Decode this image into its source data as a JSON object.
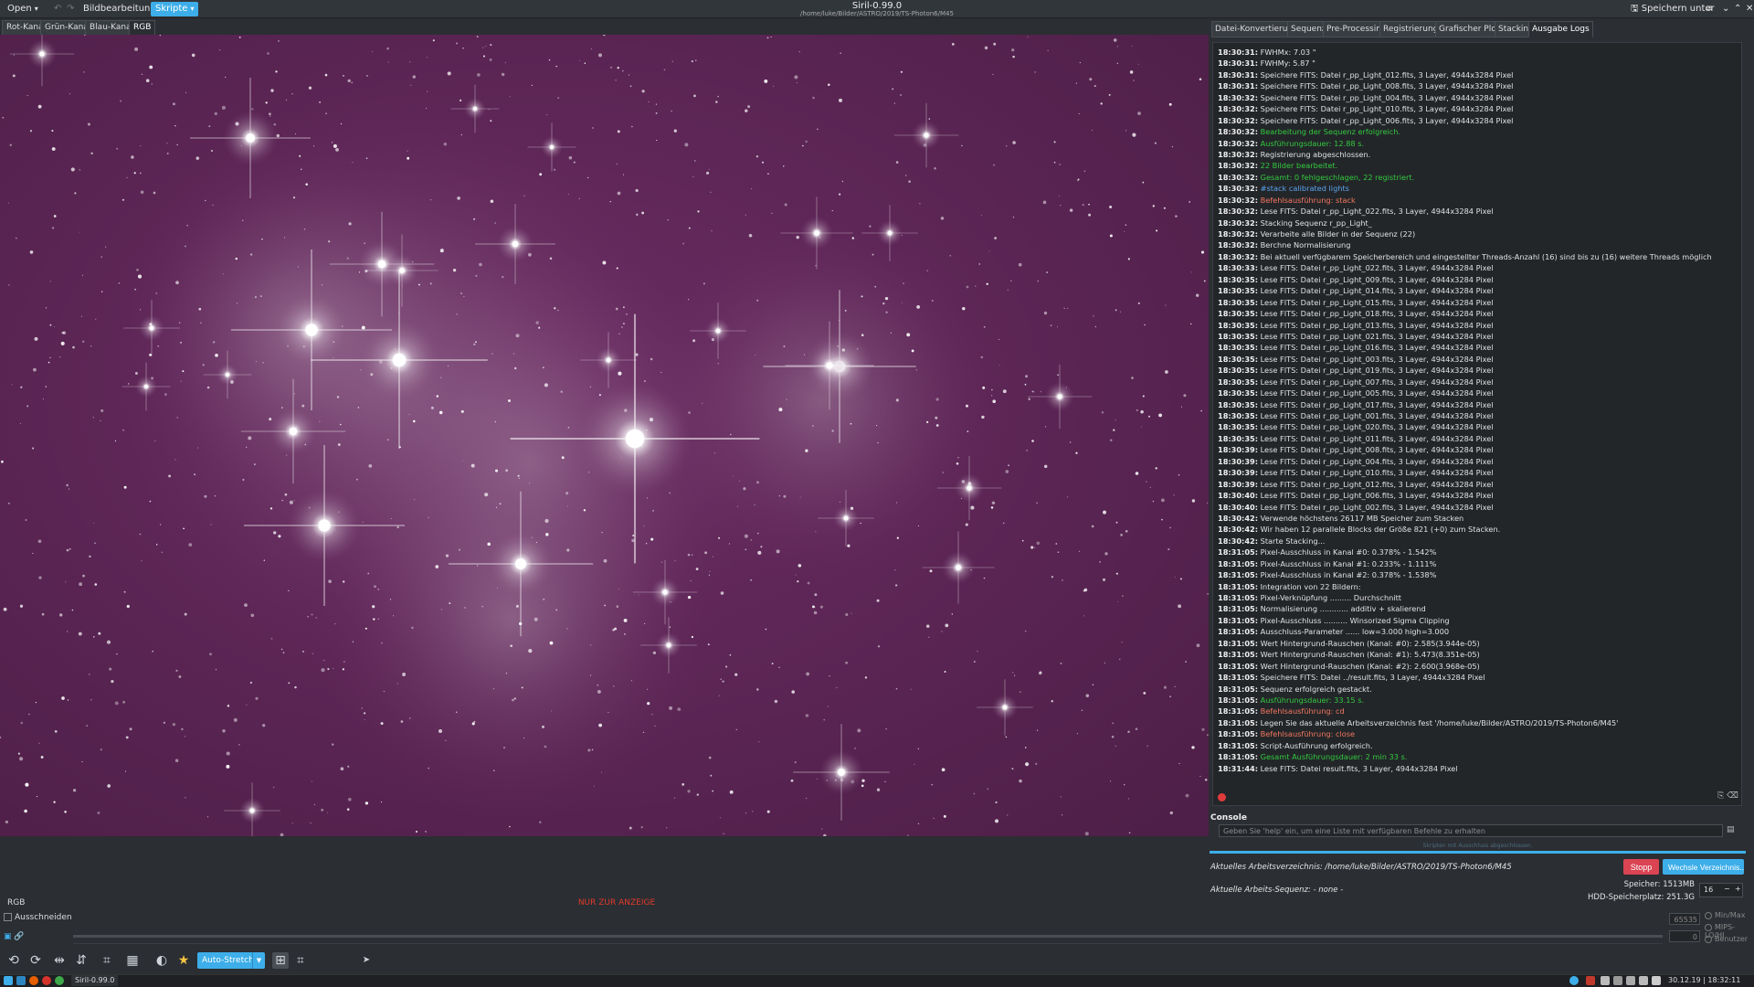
{
  "window": {
    "title": "Siril-0.99.0",
    "path": "/home/luke/Bilder/ASTRO/2019/TS-Photon6/M45"
  },
  "menu": {
    "open": "Open",
    "image_processing": "Bildbearbeitung",
    "scripts": "Skripte",
    "save_as": "Speichern unter"
  },
  "channel_tabs": [
    "Rot-Kanal",
    "Grün-Kanal",
    "Blau-Kanal",
    "RGB"
  ],
  "panel_tabs": [
    "Datei-Konvertierung",
    "Sequenz",
    "Pre-Processing",
    "Registrierung",
    "Grafischer Plot",
    "Stacking",
    "Ausgabe Logs"
  ],
  "log": [
    {
      "t": "18:30:31:",
      "m": "FWHMx:      7.03 \"",
      "c": "normal"
    },
    {
      "t": "18:30:31:",
      "m": "FWHMy:      5.87 \"",
      "c": "normal"
    },
    {
      "t": "18:30:31:",
      "m": "Speichere FITS: Datei r_pp_Light_012.fits, 3 Layer, 4944x3284 Pixel",
      "c": "normal"
    },
    {
      "t": "18:30:31:",
      "m": "Speichere FITS: Datei r_pp_Light_008.fits, 3 Layer, 4944x3284 Pixel",
      "c": "normal"
    },
    {
      "t": "18:30:32:",
      "m": "Speichere FITS: Datei r_pp_Light_004.fits, 3 Layer, 4944x3284 Pixel",
      "c": "normal"
    },
    {
      "t": "18:30:32:",
      "m": "Speichere FITS: Datei r_pp_Light_010.fits, 3 Layer, 4944x3284 Pixel",
      "c": "normal"
    },
    {
      "t": "18:30:32:",
      "m": "Speichere FITS: Datei r_pp_Light_006.fits, 3 Layer, 4944x3284 Pixel",
      "c": "normal"
    },
    {
      "t": "18:30:32:",
      "m": "Bearbeitung der Sequenz erfolgreich.",
      "c": "green"
    },
    {
      "t": "18:30:32:",
      "m": "Ausführungsdauer: 12.88 s.",
      "c": "green"
    },
    {
      "t": "18:30:32:",
      "m": "Registrierung abgeschlossen.",
      "c": "normal"
    },
    {
      "t": "18:30:32:",
      "m": "22 Bilder bearbeitet.",
      "c": "green"
    },
    {
      "t": "18:30:32:",
      "m": "Gesamt: 0 fehlgeschlagen, 22 registriert.",
      "c": "green"
    },
    {
      "t": "18:30:32:",
      "m": "#stack calibrated lights",
      "c": "blue"
    },
    {
      "t": "18:30:32:",
      "m": "Befehlsausführung: stack",
      "c": "salmon"
    },
    {
      "t": "18:30:32:",
      "m": "Lese FITS: Datei r_pp_Light_022.fits, 3 Layer, 4944x3284 Pixel",
      "c": "normal"
    },
    {
      "t": "18:30:32:",
      "m": "Stacking Sequenz r_pp_Light_",
      "c": "normal"
    },
    {
      "t": "18:30:32:",
      "m": "Verarbeite alle Bilder in der Sequenz (22)",
      "c": "normal"
    },
    {
      "t": "18:30:32:",
      "m": "Berchne Normalisierung",
      "c": "normal"
    },
    {
      "t": "18:30:32:",
      "m": "Bei aktuell verfügbarem Speicherbereich und eingestellter Threads-Anzahl (16) sind bis zu (16) weitere Threads möglich",
      "c": "normal"
    },
    {
      "t": "18:30:33:",
      "m": "Lese FITS: Datei r_pp_Light_022.fits, 3 Layer, 4944x3284 Pixel",
      "c": "normal"
    },
    {
      "t": "18:30:35:",
      "m": "Lese FITS: Datei r_pp_Light_009.fits, 3 Layer, 4944x3284 Pixel",
      "c": "normal"
    },
    {
      "t": "18:30:35:",
      "m": "Lese FITS: Datei r_pp_Light_014.fits, 3 Layer, 4944x3284 Pixel",
      "c": "normal"
    },
    {
      "t": "18:30:35:",
      "m": "Lese FITS: Datei r_pp_Light_015.fits, 3 Layer, 4944x3284 Pixel",
      "c": "normal"
    },
    {
      "t": "18:30:35:",
      "m": "Lese FITS: Datei r_pp_Light_018.fits, 3 Layer, 4944x3284 Pixel",
      "c": "normal"
    },
    {
      "t": "18:30:35:",
      "m": "Lese FITS: Datei r_pp_Light_013.fits, 3 Layer, 4944x3284 Pixel",
      "c": "normal"
    },
    {
      "t": "18:30:35:",
      "m": "Lese FITS: Datei r_pp_Light_021.fits, 3 Layer, 4944x3284 Pixel",
      "c": "normal"
    },
    {
      "t": "18:30:35:",
      "m": "Lese FITS: Datei r_pp_Light_016.fits, 3 Layer, 4944x3284 Pixel",
      "c": "normal"
    },
    {
      "t": "18:30:35:",
      "m": "Lese FITS: Datei r_pp_Light_003.fits, 3 Layer, 4944x3284 Pixel",
      "c": "normal"
    },
    {
      "t": "18:30:35:",
      "m": "Lese FITS: Datei r_pp_Light_019.fits, 3 Layer, 4944x3284 Pixel",
      "c": "normal"
    },
    {
      "t": "18:30:35:",
      "m": "Lese FITS: Datei r_pp_Light_007.fits, 3 Layer, 4944x3284 Pixel",
      "c": "normal"
    },
    {
      "t": "18:30:35:",
      "m": "Lese FITS: Datei r_pp_Light_005.fits, 3 Layer, 4944x3284 Pixel",
      "c": "normal"
    },
    {
      "t": "18:30:35:",
      "m": "Lese FITS: Datei r_pp_Light_017.fits, 3 Layer, 4944x3284 Pixel",
      "c": "normal"
    },
    {
      "t": "18:30:35:",
      "m": "Lese FITS: Datei r_pp_Light_001.fits, 3 Layer, 4944x3284 Pixel",
      "c": "normal"
    },
    {
      "t": "18:30:35:",
      "m": "Lese FITS: Datei r_pp_Light_020.fits, 3 Layer, 4944x3284 Pixel",
      "c": "normal"
    },
    {
      "t": "18:30:35:",
      "m": "Lese FITS: Datei r_pp_Light_011.fits, 3 Layer, 4944x3284 Pixel",
      "c": "normal"
    },
    {
      "t": "18:30:39:",
      "m": "Lese FITS: Datei r_pp_Light_008.fits, 3 Layer, 4944x3284 Pixel",
      "c": "normal"
    },
    {
      "t": "18:30:39:",
      "m": "Lese FITS: Datei r_pp_Light_004.fits, 3 Layer, 4944x3284 Pixel",
      "c": "normal"
    },
    {
      "t": "18:30:39:",
      "m": "Lese FITS: Datei r_pp_Light_010.fits, 3 Layer, 4944x3284 Pixel",
      "c": "normal"
    },
    {
      "t": "18:30:39:",
      "m": "Lese FITS: Datei r_pp_Light_012.fits, 3 Layer, 4944x3284 Pixel",
      "c": "normal"
    },
    {
      "t": "18:30:40:",
      "m": "Lese FITS: Datei r_pp_Light_006.fits, 3 Layer, 4944x3284 Pixel",
      "c": "normal"
    },
    {
      "t": "18:30:40:",
      "m": "Lese FITS: Datei r_pp_Light_002.fits, 3 Layer, 4944x3284 Pixel",
      "c": "normal"
    },
    {
      "t": "18:30:42:",
      "m": "Verwende höchstens 26117 MB Speicher zum Stacken",
      "c": "normal"
    },
    {
      "t": "18:30:42:",
      "m": "Wir haben 12 parallele Blocks der Größe 821 (+0) zum Stacken.",
      "c": "normal"
    },
    {
      "t": "18:30:42:",
      "m": "Starte Stacking...",
      "c": "normal"
    },
    {
      "t": "18:31:05:",
      "m": "Pixel-Ausschluss in Kanal #0: 0.378% - 1.542%",
      "c": "normal"
    },
    {
      "t": "18:31:05:",
      "m": "Pixel-Ausschluss in Kanal #1: 0.233% - 1.111%",
      "c": "normal"
    },
    {
      "t": "18:31:05:",
      "m": "Pixel-Ausschluss in Kanal #2: 0.378% - 1.538%",
      "c": "normal"
    },
    {
      "t": "18:31:05:",
      "m": "Integration von 22 Bildern:",
      "c": "normal"
    },
    {
      "t": "18:31:05:",
      "m": "Pixel-Verknüpfung ......... Durchschnitt",
      "c": "normal"
    },
    {
      "t": "18:31:05:",
      "m": "Normalisierung ............ additiv + skalierend",
      "c": "normal"
    },
    {
      "t": "18:31:05:",
      "m": "Pixel-Ausschluss .......... Winsorized Sigma Clipping",
      "c": "normal"
    },
    {
      "t": "18:31:05:",
      "m": "Ausschluss-Parameter ...... low=3.000 high=3.000",
      "c": "normal"
    },
    {
      "t": "18:31:05:",
      "m": "Wert Hintergrund-Rauschen (Kanal: #0): 2.585(3.944e-05)",
      "c": "normal"
    },
    {
      "t": "18:31:05:",
      "m": "Wert Hintergrund-Rauschen (Kanal: #1): 5.473(8.351e-05)",
      "c": "normal"
    },
    {
      "t": "18:31:05:",
      "m": "Wert Hintergrund-Rauschen (Kanal: #2): 2.600(3.968e-05)",
      "c": "normal"
    },
    {
      "t": "18:31:05:",
      "m": "Speichere FITS: Datei ../result.fits, 3 Layer, 4944x3284 Pixel",
      "c": "normal"
    },
    {
      "t": "18:31:05:",
      "m": "Sequenz erfolgreich gestackt.",
      "c": "normal"
    },
    {
      "t": "18:31:05:",
      "m": "Ausführungsdauer: 33.15 s.",
      "c": "green"
    },
    {
      "t": "18:31:05:",
      "m": "Befehlsausführung: cd",
      "c": "salmon"
    },
    {
      "t": "18:31:05:",
      "m": "Legen Sie das aktuelle Arbeitsverzeichnis fest '/home/luke/Bilder/ASTRO/2019/TS-Photon6/M45'",
      "c": "normal"
    },
    {
      "t": "18:31:05:",
      "m": "Befehlsausführung: close",
      "c": "salmon"
    },
    {
      "t": "18:31:05:",
      "m": "Script-Ausführung erfolgreich.",
      "c": "normal"
    },
    {
      "t": "18:31:05:",
      "m": "Gesamt Ausführungsdauer: 2 min 33 s.",
      "c": "green"
    },
    {
      "t": "18:31:44:",
      "m": "Lese FITS: Datei result.fits, 3 Layer, 4944x3284 Pixel",
      "c": "normal"
    }
  ],
  "console": {
    "label": "Console",
    "placeholder": "Geben Sie 'help' ein, um eine Liste mit verfügbaren Befehle zu erhalten",
    "progress_text": "Skripten mit Ausschluss abgeschlossen."
  },
  "status": {
    "cwd": "Aktuelles Arbeitsverzeichnis: /home/luke/Bilder/ASTRO/2019/TS-Photon6/M45",
    "sequence": "Aktuelle Arbeits-Sequenz: - none -",
    "memory": "Speicher: 1513MB",
    "disk": "HDD-Speicherplatz: 251.3G",
    "threads": "16",
    "stop": "Stopp",
    "change_dir": "Wechsle Verzeichnis..."
  },
  "image_panel": {
    "channel_label": "RGB",
    "display_only": "NUR ZUR ANZEIGE",
    "crop_label": "Ausschneiden",
    "val_high": "65535",
    "val_low": "0",
    "scale_options": [
      "Min/Max",
      "MIPS-LO/HI",
      "Benutzer"
    ],
    "autostretch": "Auto-Stretch"
  },
  "taskbar": {
    "task": "Siril-0.99.0",
    "clock": "30.12.19 | 18:32:11"
  },
  "colors": {
    "accent": "#3daee9",
    "stop": "#da4453",
    "log_green": "#33c93f",
    "log_salmon": "#f2765f",
    "log_blue": "#5aa4ee",
    "sky": "#5a2453"
  },
  "icons": {
    "toolbar": [
      "rotate-left-icon",
      "rotate-right-icon",
      "mirror-x-icon",
      "mirror-y-icon",
      "histogram-icon",
      "layers-icon",
      "invert-icon",
      "star-icon",
      "grid-icon",
      "crop-icon"
    ]
  }
}
